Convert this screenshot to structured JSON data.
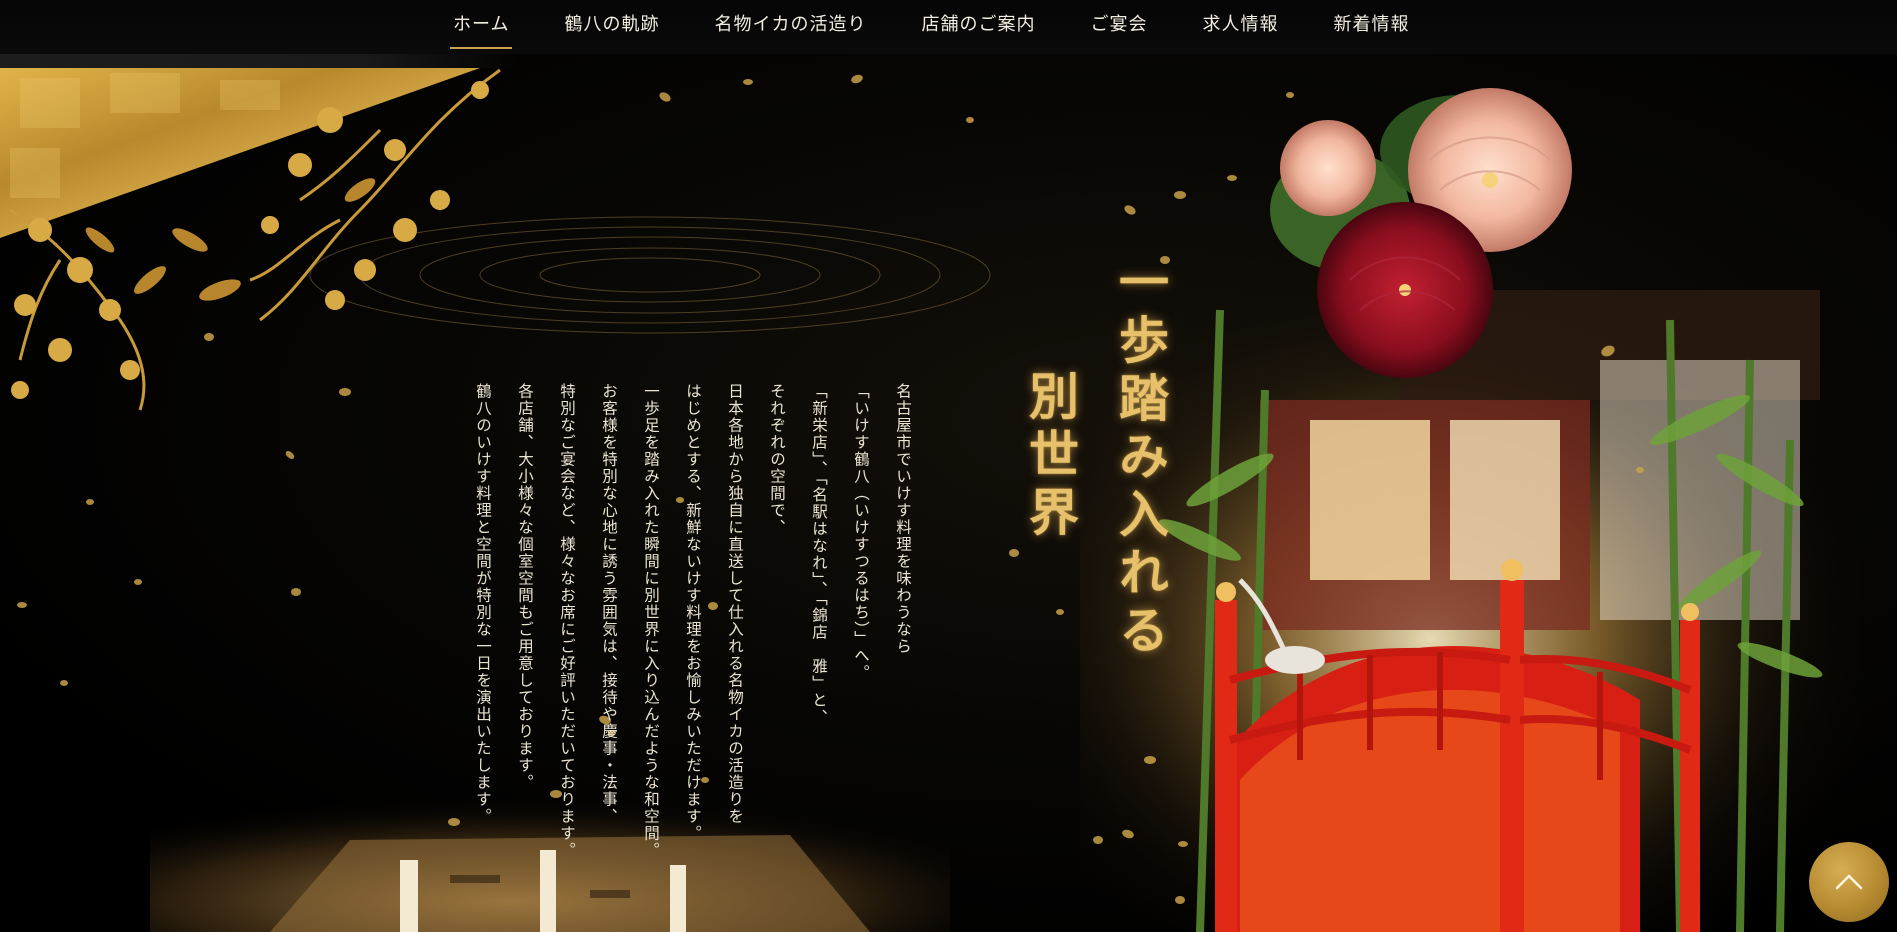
{
  "nav": {
    "items": [
      {
        "label": "ホーム",
        "active": true
      },
      {
        "label": "鶴八の軌跡",
        "active": false
      },
      {
        "label": "名物イカの活造り",
        "active": false
      },
      {
        "label": "店舗のご案内",
        "active": false
      },
      {
        "label": "ご宴会",
        "active": false
      },
      {
        "label": "求人情報",
        "active": false
      },
      {
        "label": "新着情報",
        "active": false
      }
    ]
  },
  "hero": {
    "heading_line1": "一歩踏み入れる",
    "heading_line2": "別世界",
    "paragraph": [
      "名古屋市でいけす料理を味わうなら",
      "「いけす鶴八（いけすつるはち）」へ。",
      "「新栄店」、「名駅はなれ」、「錦店　雅」と、",
      "それぞれの空間で、",
      "日本各地から独自に直送して仕入れる名物イカの活造りを",
      "はじめとする、新鮮ないけす料理をお愉しみいただけます。",
      "一歩足を踏み入れた瞬間に別世界に入り込んだような和空間。",
      "お客様を特別な心地に誘う雰囲気は、接待や慶事・法事、",
      "特別なご宴会など、様々なお席にご好評いただいております。",
      "各店舗、大小様々な個室空間もご用意しております。",
      "鶴八のいけす料理と空間が特別な一日を演出いたします。"
    ]
  },
  "icons": {
    "back_to_top": "chevron-up-icon"
  },
  "colors": {
    "accent_gold": "#c9a24a",
    "heading_gold": "#e6c06a",
    "bridge_red": "#d81f14",
    "background": "#000000"
  }
}
